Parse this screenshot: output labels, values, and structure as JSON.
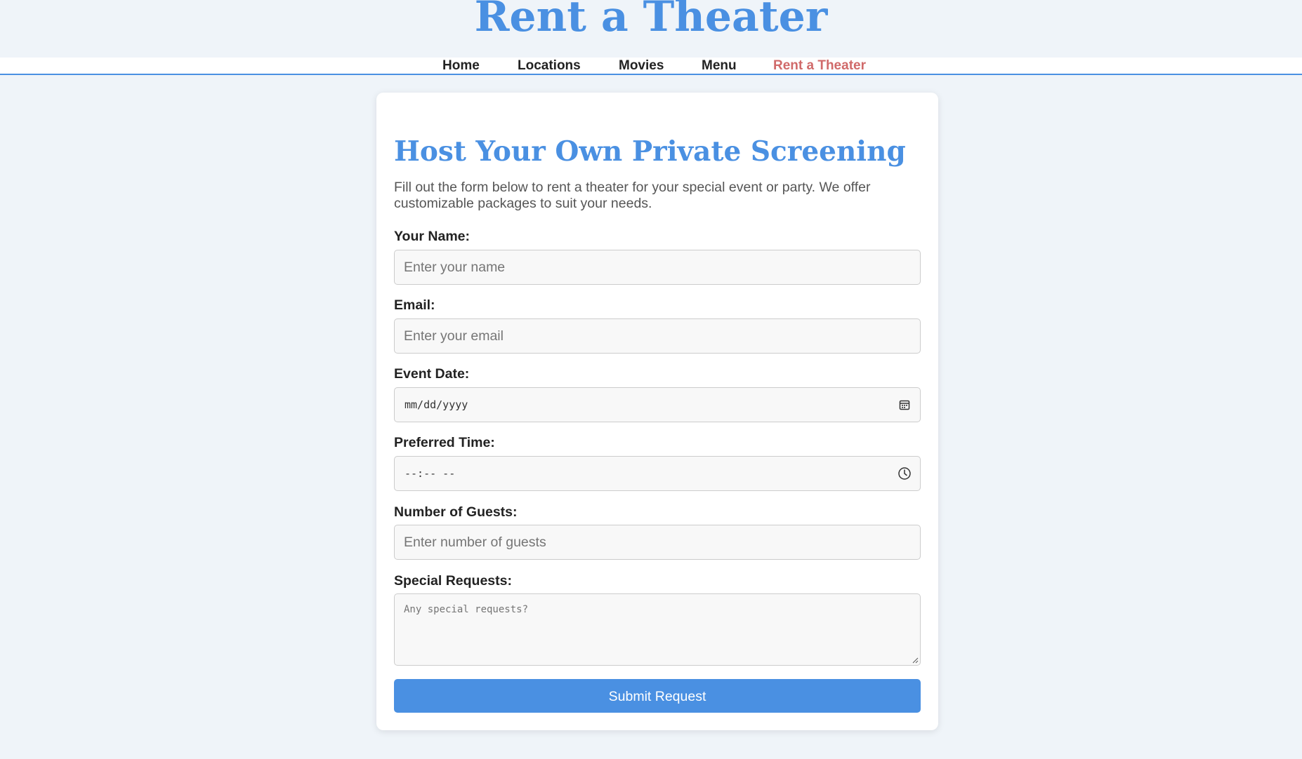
{
  "site": {
    "title": "Rent a Theater"
  },
  "nav": {
    "items": [
      {
        "label": "Home"
      },
      {
        "label": "Locations"
      },
      {
        "label": "Movies"
      },
      {
        "label": "Menu"
      },
      {
        "label": "Rent a Theater",
        "active": true
      }
    ]
  },
  "form": {
    "heading": "Host Your Own Private Screening",
    "intro": "Fill out the form below to rent a theater for your special event or party. We offer customizable packages to suit your needs.",
    "name": {
      "label": "Your Name:",
      "placeholder": "Enter your name",
      "value": ""
    },
    "email": {
      "label": "Email:",
      "placeholder": "Enter your email",
      "value": ""
    },
    "date": {
      "label": "Event Date:",
      "display": "mm/dd/yyyy",
      "icon": "calendar-icon"
    },
    "time": {
      "label": "Preferred Time:",
      "display": "--:-- --",
      "icon": "clock-icon"
    },
    "guests": {
      "label": "Number of Guests:",
      "placeholder": "Enter number of guests",
      "value": ""
    },
    "requests": {
      "label": "Special Requests:",
      "placeholder": "Any special requests?",
      "value": ""
    },
    "submit_label": "Submit Request"
  },
  "colors": {
    "accent": "#4a90e2",
    "active_nav": "#d06a6a",
    "page_background": "#eff4f9",
    "card_background": "#ffffff",
    "field_background": "#f8f8f8"
  }
}
